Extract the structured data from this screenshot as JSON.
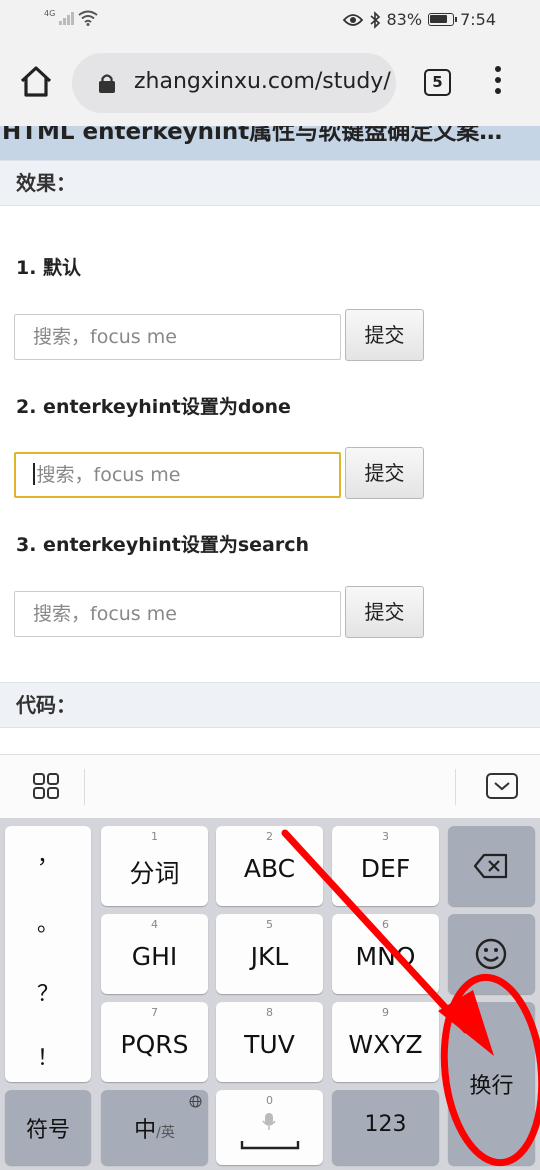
{
  "status_bar": {
    "network": "4G",
    "battery_pct": "83%",
    "battery_level": 0.83,
    "time": "7:54"
  },
  "browser": {
    "url": "zhangxinxu.com/study/",
    "tab_count": "5"
  },
  "page": {
    "title": "HTML enterkeyhint属性与软键盘确定文案…",
    "effect_heading": "效果：",
    "examples": [
      {
        "label": "1. 默认",
        "placeholder": "搜索，focus me",
        "button": "提交",
        "focused": false
      },
      {
        "label": "2. enterkeyhint设置为done",
        "placeholder": "搜索，focus me",
        "button": "提交",
        "focused": true
      },
      {
        "label": "3. enterkeyhint设置为search",
        "placeholder": "搜索，focus me",
        "button": "提交",
        "focused": false
      }
    ],
    "code_heading": "代码："
  },
  "keyboard": {
    "punctuation": [
      "，",
      "。",
      "？",
      "！"
    ],
    "keys": [
      {
        "num": "1",
        "label": "分词"
      },
      {
        "num": "2",
        "label": "ABC"
      },
      {
        "num": "3",
        "label": "DEF"
      },
      {
        "num": "4",
        "label": "GHI"
      },
      {
        "num": "5",
        "label": "JKL"
      },
      {
        "num": "6",
        "label": "MNO"
      },
      {
        "num": "7",
        "label": "PQRS"
      },
      {
        "num": "8",
        "label": "TUV"
      },
      {
        "num": "9",
        "label": "WXYZ"
      }
    ],
    "symbols_label": "符号",
    "lang_main": "中",
    "lang_alt": "/英",
    "space_num": "0",
    "num_mode_label": "123",
    "enter_label": "换行",
    "delete_icon": "backspace-icon",
    "emoji_icon": "smiley-icon",
    "mic_icon": "microphone-icon",
    "globe_icon": "globe-icon"
  },
  "colors": {
    "annotation": "#ff0000",
    "focus_border": "#e0b42a",
    "section_bg": "#eef2f7",
    "title_bg": "#c6d5e6"
  }
}
